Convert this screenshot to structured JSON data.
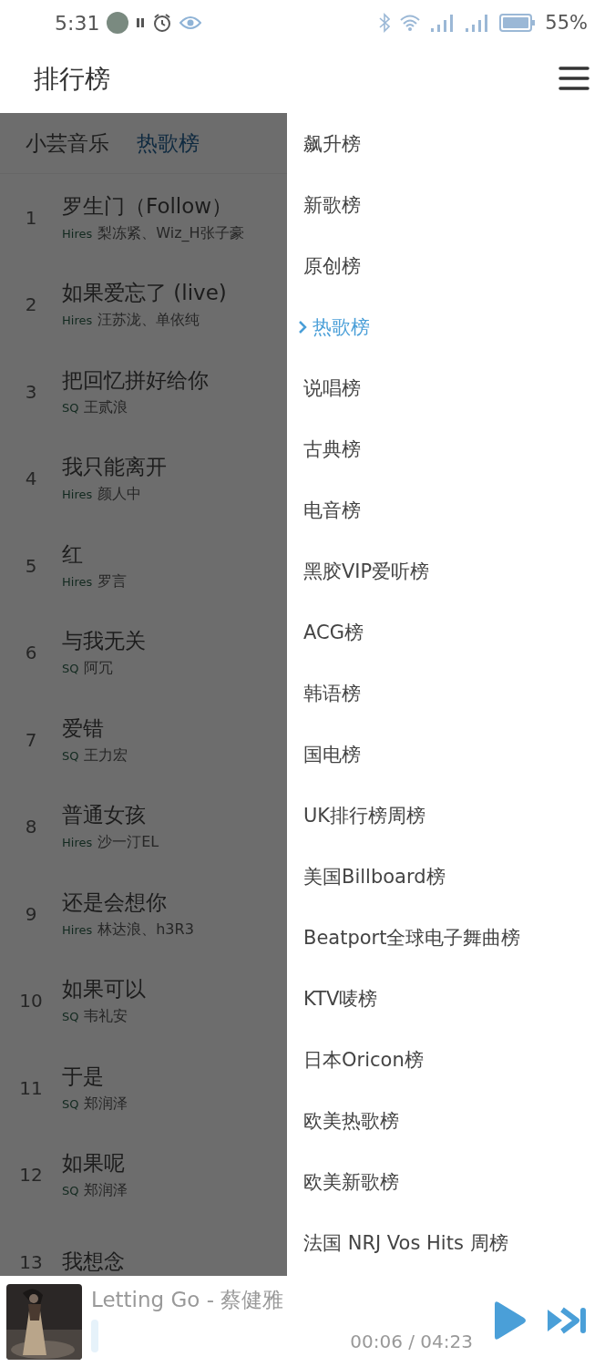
{
  "status_bar": {
    "time": "5:31",
    "battery": "55%"
  },
  "header": {
    "title": "排行榜"
  },
  "chart_panel": {
    "source": "小芸音乐",
    "chart": "热歌榜",
    "songs": [
      {
        "rank": "1",
        "title": "罗生门（Follow）",
        "quality": "Hires",
        "artist": "梨冻紧、Wiz_H张子豪"
      },
      {
        "rank": "2",
        "title": "如果爱忘了 (live)",
        "quality": "Hires",
        "artist": "汪苏泷、单依纯"
      },
      {
        "rank": "3",
        "title": "把回忆拼好给你",
        "quality": "SQ",
        "artist": "王贰浪"
      },
      {
        "rank": "4",
        "title": "我只能离开",
        "quality": "Hires",
        "artist": "颜人中"
      },
      {
        "rank": "5",
        "title": "红",
        "quality": "Hires",
        "artist": "罗言"
      },
      {
        "rank": "6",
        "title": "与我无关",
        "quality": "SQ",
        "artist": "阿冗"
      },
      {
        "rank": "7",
        "title": "爱错",
        "quality": "SQ",
        "artist": "王力宏"
      },
      {
        "rank": "8",
        "title": "普通女孩",
        "quality": "Hires",
        "artist": "沙一汀EL"
      },
      {
        "rank": "9",
        "title": "还是会想你",
        "quality": "Hires",
        "artist": "林达浪、h3R3"
      },
      {
        "rank": "10",
        "title": "如果可以",
        "quality": "SQ",
        "artist": "韦礼安"
      },
      {
        "rank": "11",
        "title": "于是",
        "quality": "SQ",
        "artist": "郑润泽"
      },
      {
        "rank": "12",
        "title": "如果呢",
        "quality": "SQ",
        "artist": "郑润泽"
      },
      {
        "rank": "13",
        "title": "我想念"
      }
    ]
  },
  "drawer": {
    "items": [
      {
        "label": "飙升榜",
        "selected": false
      },
      {
        "label": "新歌榜",
        "selected": false
      },
      {
        "label": "原创榜",
        "selected": false
      },
      {
        "label": "热歌榜",
        "selected": true
      },
      {
        "label": "说唱榜",
        "selected": false
      },
      {
        "label": "古典榜",
        "selected": false
      },
      {
        "label": "电音榜",
        "selected": false
      },
      {
        "label": "黑胶VIP爱听榜",
        "selected": false
      },
      {
        "label": "ACG榜",
        "selected": false
      },
      {
        "label": "韩语榜",
        "selected": false
      },
      {
        "label": "国电榜",
        "selected": false
      },
      {
        "label": "UK排行榜周榜",
        "selected": false
      },
      {
        "label": "美国Billboard榜",
        "selected": false
      },
      {
        "label": "Beatport全球电子舞曲榜",
        "selected": false
      },
      {
        "label": "KTV唛榜",
        "selected": false
      },
      {
        "label": "日本Oricon榜",
        "selected": false
      },
      {
        "label": "欧美热歌榜",
        "selected": false
      },
      {
        "label": "欧美新歌榜",
        "selected": false
      },
      {
        "label": "法国 NRJ Vos Hits 周榜",
        "selected": false
      }
    ]
  },
  "player": {
    "title": "Letting Go - 蔡健雅",
    "time": "00:06 / 04:23"
  }
}
